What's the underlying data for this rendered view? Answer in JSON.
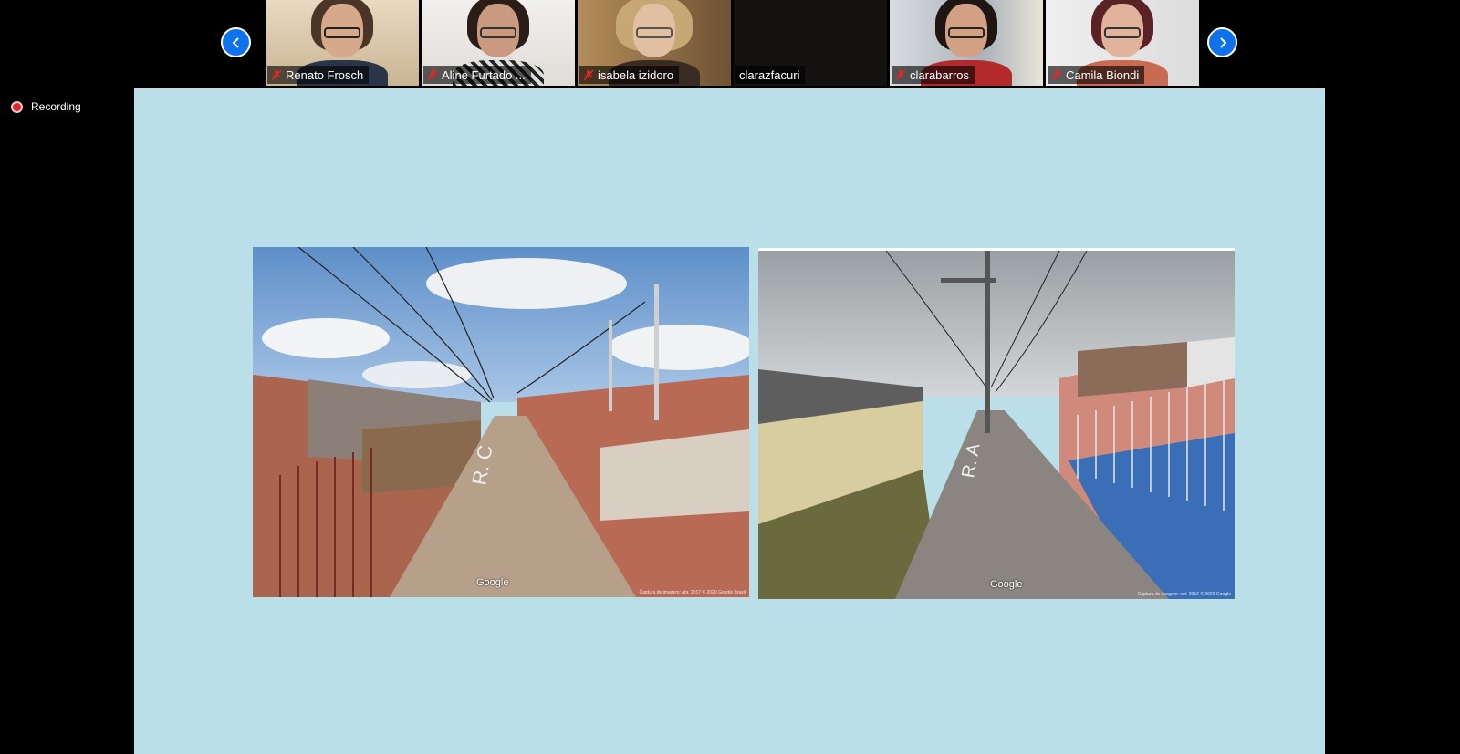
{
  "gallery": {
    "prev_icon": "chevron-left-icon",
    "next_icon": "chevron-right-icon",
    "participants": [
      {
        "name": "Renato Frosch",
        "muted": true
      },
      {
        "name": "Aline Furtado ...",
        "muted": true
      },
      {
        "name": "isabela izidoro",
        "muted": true
      },
      {
        "name": "clarazfacuri",
        "muted": false
      },
      {
        "name": "clarabarros",
        "muted": true
      },
      {
        "name": "Camila Biondi",
        "muted": true
      }
    ]
  },
  "recording": {
    "label": "Recording"
  },
  "shared_screen": {
    "background": "#badfe8",
    "photos": [
      {
        "street_label": "R. C",
        "watermark": "Google",
        "caption": "Captura de imagem: abr. 2017   © 2020 Google   Brasil"
      },
      {
        "street_label": "R. A",
        "watermark": "Google",
        "caption": "Captura de imagem: set. 2016   © 2020 Google"
      }
    ]
  },
  "colors": {
    "accent": "#0e72ed",
    "recording": "#e02828",
    "muted": "#e02828"
  }
}
